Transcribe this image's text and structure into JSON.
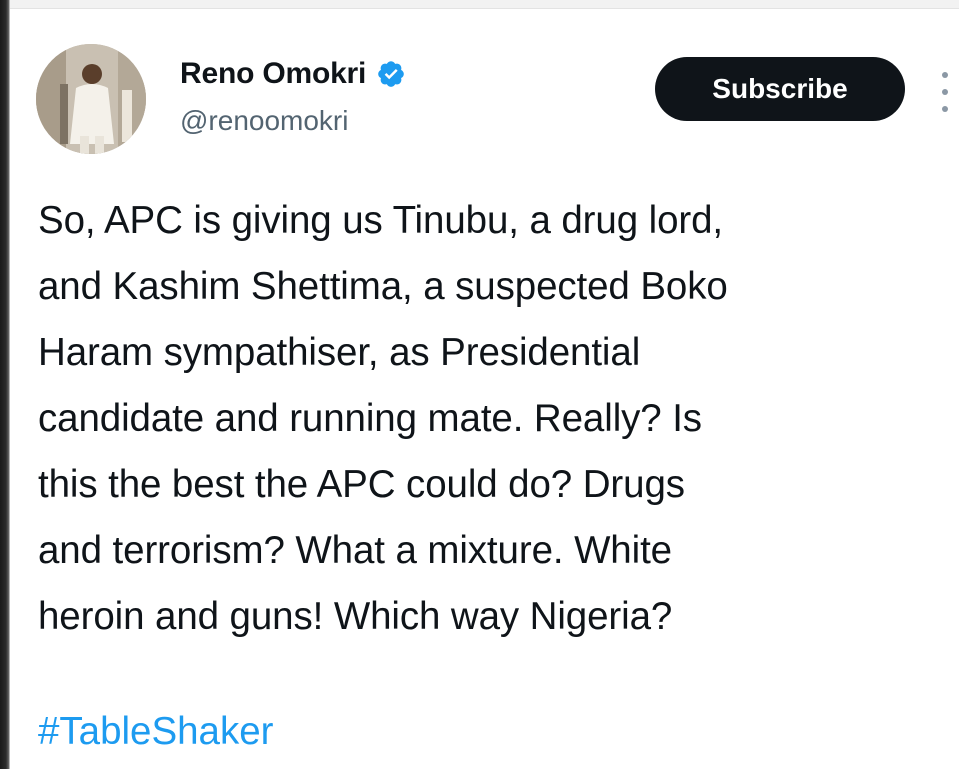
{
  "author": {
    "display_name": "Reno Omokri",
    "handle": "@renoomokri",
    "verified": true,
    "verified_color": "#1d9bf0"
  },
  "actions": {
    "subscribe_label": "Subscribe"
  },
  "tweet": {
    "lines": [
      "So, APC is giving us Tinubu, a drug lord,",
      "and Kashim Shettima, a suspected Boko",
      "Haram sympathiser, as Presidential",
      "candidate and running mate. Really? Is",
      "this the best the APC could do? Drugs",
      "and terrorism? What a mixture. White",
      "heroin and guns! Which way Nigeria?"
    ],
    "hashtag": "#TableShaker"
  },
  "colors": {
    "text": "#0f1419",
    "secondary_text": "#536471",
    "link": "#1d9bf0",
    "button_bg": "#0f1419",
    "button_text": "#ffffff"
  }
}
